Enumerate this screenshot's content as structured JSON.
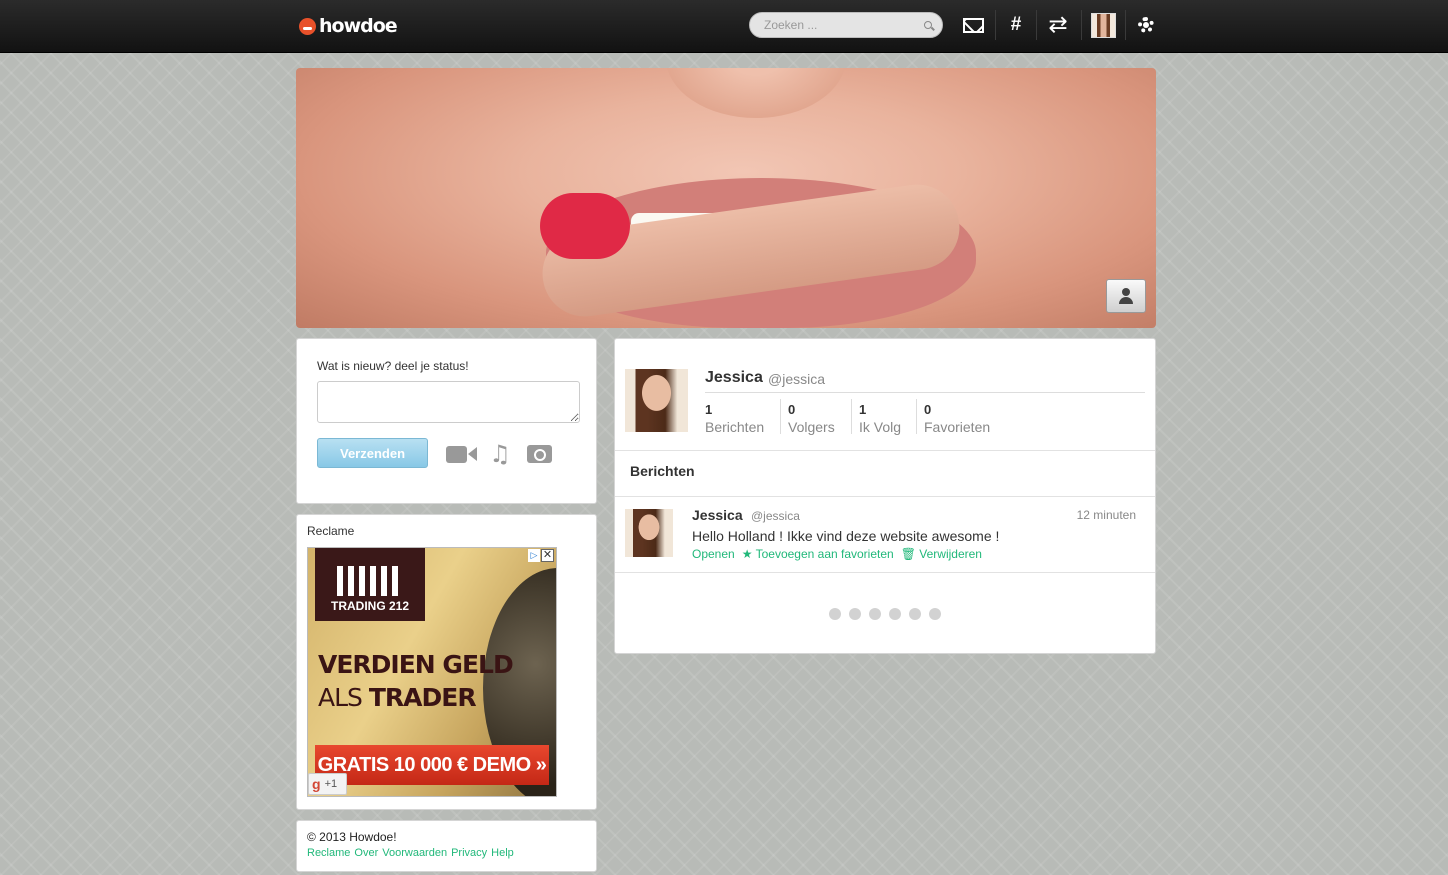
{
  "header": {
    "logo_text": "howdoe",
    "search_placeholder": "Zoeken ...",
    "hashtag_label": "#",
    "swap_label": "⇄"
  },
  "status": {
    "prompt": "Wat is nieuw? deel je status!",
    "input_value": "",
    "send_label": "Verzenden",
    "music_icon": "♫"
  },
  "ad": {
    "label": "Reclame",
    "brand": "TRADING 212",
    "headline_1": "VERDIEN GELD",
    "headline_2_prefix": "ALS ",
    "headline_2_bold": "TRADER",
    "cta": "GRATIS 10 000 € DEMO »",
    "gplus": "+1",
    "gplus_mark": "g",
    "close": "✕",
    "info": "▷"
  },
  "footer": {
    "copyright": "© 2013 Howdoe!",
    "links": [
      "Reclame",
      "Over",
      "Voorwaarden",
      "Privacy",
      "Help"
    ]
  },
  "profile": {
    "name": "Jessica",
    "handle": "@jessica",
    "stats": [
      {
        "value": "1",
        "label": "Berichten"
      },
      {
        "value": "0",
        "label": "Volgers"
      },
      {
        "value": "1",
        "label": "Ik Volg"
      },
      {
        "value": "0",
        "label": "Favorieten"
      }
    ]
  },
  "messages": {
    "title": "Berichten",
    "posts": [
      {
        "name": "Jessica",
        "handle": "@jessica",
        "time": "12 minuten",
        "text": "Hello Holland ! Ikke vind deze website awesome !",
        "actions": {
          "open": "Openen",
          "favorite": "Toevoegen aan favorieten",
          "delete": "Verwijderen",
          "star_icon": "★",
          "trash_icon": "🗑"
        }
      }
    ],
    "loader_dots": 6
  },
  "colors": {
    "accent": "#21b87a",
    "send_button": "#88c8e6",
    "logo_orange": "#e8512a"
  }
}
